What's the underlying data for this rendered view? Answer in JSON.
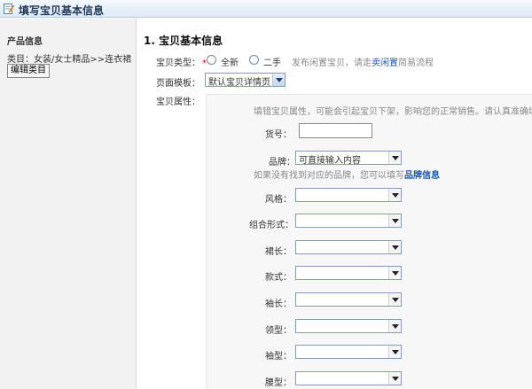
{
  "header": {
    "title": "填写宝贝基本信息",
    "icon": "edit-form-icon"
  },
  "sidebar": {
    "title": "产品信息",
    "category_path": "类目：女装/女士精品>>连衣裙",
    "edit_button": "编辑类目"
  },
  "section": {
    "title": "1. 宝贝基本信息"
  },
  "item_type": {
    "label": "宝贝类型：",
    "required_mark": "*",
    "options": [
      "全新",
      "二手"
    ],
    "hint_prefix": "发布闲置宝贝，请走",
    "hint_link": "卖闲置",
    "hint_suffix": "简易流程"
  },
  "page_template": {
    "label": "页面模板：",
    "value": "默认宝贝详情页"
  },
  "attributes": {
    "label": "宝贝属性：",
    "warning": "填错宝贝属性，可能会引起宝贝下架，影响您的正常销售。请认真准确填写",
    "sku": {
      "label": "货号：",
      "value": ""
    },
    "brand": {
      "label": "品牌：",
      "value": "可直接输入内容",
      "hint_prefix": "如果没有找到对应的品牌，您可以填写",
      "hint_link": "品牌信息"
    },
    "fields": [
      {
        "label": "风格：",
        "value": ""
      },
      {
        "label": "组合形式：",
        "value": ""
      },
      {
        "label": "裙长：",
        "value": ""
      },
      {
        "label": "款式：",
        "value": ""
      },
      {
        "label": "袖长：",
        "value": ""
      },
      {
        "label": "领型：",
        "value": ""
      },
      {
        "label": "袖型：",
        "value": ""
      },
      {
        "label": "腰型：",
        "value": ""
      }
    ]
  },
  "colors": {
    "required": "#ee0000",
    "link": "#1a57b4",
    "header_bg": "#dceaf7"
  }
}
